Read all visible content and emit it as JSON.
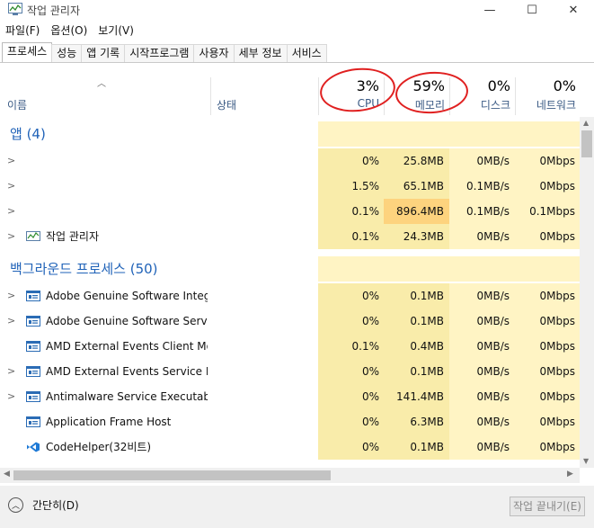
{
  "window": {
    "title": "작업 관리자",
    "minimize": "—",
    "maximize": "☐",
    "close": "✕"
  },
  "menu": {
    "items": [
      "파일(F)",
      "옵션(O)",
      "보기(V)"
    ]
  },
  "tabs": [
    "프로세스",
    "성능",
    "앱 기록",
    "시작프로그램",
    "사용자",
    "세부 정보",
    "서비스"
  ],
  "active_tab": "프로세스",
  "columns": {
    "name": "이름",
    "status": "상태",
    "cpu": {
      "pct": "3%",
      "label": "CPU"
    },
    "memory": {
      "pct": "59%",
      "label": "메모리"
    },
    "disk": {
      "pct": "0%",
      "label": "디스크"
    },
    "network": {
      "pct": "0%",
      "label": "네트워크"
    }
  },
  "groups": [
    {
      "header": "앱 (4)",
      "rows": [
        {
          "expand": true,
          "icon": "",
          "name": "",
          "cpu": "0%",
          "mem": "25.8MB",
          "disk": "0MB/s",
          "net": "0Mbps"
        },
        {
          "expand": true,
          "icon": "",
          "name": "",
          "cpu": "1.5%",
          "mem": "65.1MB",
          "disk": "0.1MB/s",
          "net": "0Mbps"
        },
        {
          "expand": true,
          "icon": "",
          "name": "",
          "cpu": "0.1%",
          "mem": "896.4MB",
          "disk": "0.1MB/s",
          "net": "0.1Mbps"
        },
        {
          "expand": true,
          "icon": "task-manager-icon",
          "name": "작업 관리자",
          "cpu": "0.1%",
          "mem": "24.3MB",
          "disk": "0MB/s",
          "net": "0Mbps"
        }
      ]
    },
    {
      "header": "백그라운드 프로세스 (50)",
      "rows": [
        {
          "expand": true,
          "icon": "service-icon",
          "name": "Adobe Genuine Software Integr...",
          "cpu": "0%",
          "mem": "0.1MB",
          "disk": "0MB/s",
          "net": "0Mbps"
        },
        {
          "expand": true,
          "icon": "service-icon",
          "name": "Adobe Genuine Software Servi...",
          "cpu": "0%",
          "mem": "0.1MB",
          "disk": "0MB/s",
          "net": "0Mbps"
        },
        {
          "expand": false,
          "icon": "service-icon",
          "name": "AMD External Events Client Mo...",
          "cpu": "0.1%",
          "mem": "0.4MB",
          "disk": "0MB/s",
          "net": "0Mbps"
        },
        {
          "expand": true,
          "icon": "service-icon",
          "name": "AMD External Events Service M...",
          "cpu": "0%",
          "mem": "0.1MB",
          "disk": "0MB/s",
          "net": "0Mbps"
        },
        {
          "expand": true,
          "icon": "service-icon",
          "name": "Antimalware Service Executable",
          "cpu": "0%",
          "mem": "141.4MB",
          "disk": "0MB/s",
          "net": "0Mbps"
        },
        {
          "expand": false,
          "icon": "service-icon",
          "name": "Application Frame Host",
          "cpu": "0%",
          "mem": "6.3MB",
          "disk": "0MB/s",
          "net": "0Mbps"
        },
        {
          "expand": false,
          "icon": "vscode-icon",
          "name": "CodeHelper(32비트)",
          "cpu": "0%",
          "mem": "0.1MB",
          "disk": "0MB/s",
          "net": "0Mbps"
        }
      ]
    }
  ],
  "footer": {
    "fewer_details": "간단히(D)",
    "end_task": "작업 끝내기(E)"
  },
  "colors": {
    "heat_light": "#fff4c4",
    "heat_medium": "#f9ecaa",
    "heat_strong": "#fdd37e",
    "group_header": "#1f62b8",
    "annotation_red": "#e02020"
  }
}
